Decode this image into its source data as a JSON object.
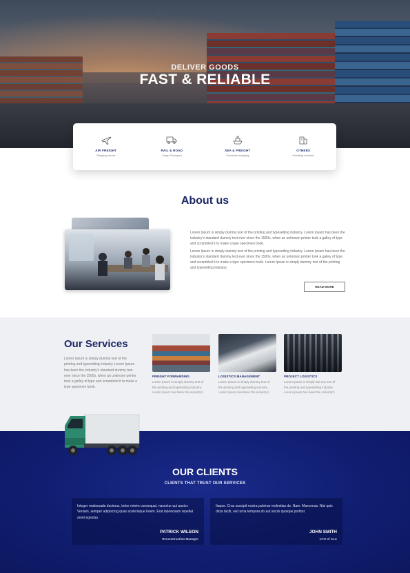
{
  "hero": {
    "subtitle": "DELIVER GOODS",
    "title": "FAST & RELIABLE"
  },
  "features": [
    {
      "icon": "airplane-icon",
      "title": "AIR FREIGHT",
      "subtitle": "Shipping via air"
    },
    {
      "icon": "truck-icon",
      "title": "RAIL & ROAD",
      "subtitle": "Cargo Transport"
    },
    {
      "icon": "ship-icon",
      "title": "SEA & FREIGHT",
      "subtitle": "Container shipping"
    },
    {
      "icon": "box-icon",
      "title": "OTHERS",
      "subtitle": "Handling services"
    }
  ],
  "about": {
    "title": "About us",
    "paragraph1": "Lorem Ipsum is simply dummy text of the printing and typesetting industry. Lorem Ipsum has been the industry's standard dummy text ever since the 1500s, when an unknown printer took a galley of type and scrambled it to make a type specimen book.",
    "paragraph2": "Lorem Ipsum is simply dummy text of the printing and typesetting industry. Lorem Ipsum has been the industry's standard dummy text ever since the 1500s, when an unknown printer took a galley of type and scrambled it to make a type specimen book. Lorem Ipsum is simply dummy text of the printing and typesetting industry.",
    "button": "READ MORE"
  },
  "services": {
    "title": "Our Services",
    "text": "Lorem Ipsum is simply dummy text of the printing and typesetting industry. Lorem Ipsum has been the industry's standard dummy text ever since the 1500s, when an unknown printer took a galley of type and scrambled it to make a type specimen book.",
    "cards": [
      {
        "title": "FREIGHT FORWARDING",
        "desc": "Lorem Ipsum is simply dummy text of the printing and typesetting industry. Lorem Ipsum has been the industry's"
      },
      {
        "title": "LOGISTICS MANAGEMENT",
        "desc": "Lorem Ipsum is simply dummy text of the printing and typesetting industry. Lorem Ipsum has been the industry's"
      },
      {
        "title": "PROJECT LOGISTICS",
        "desc": "Lorem Ipsum is simply dummy text of the printing and typesetting industry. Lorem Ipsum has been the industry's"
      }
    ]
  },
  "clients": {
    "title": "OUR CLIENTS",
    "subtitle": "CLIENTS THAT TRUST OUR SERVICES",
    "testimonials": [
      {
        "quote": "Integer malesuada ducimus, tortor minim consequat, nascetur qui auctor. Veniam, semper adipiscing quas scelerisque lorem. Erat laboriosam repellat amet egestas.",
        "name": "PATRICK WILSON",
        "role": "Reconstruction Manager"
      },
      {
        "quote": "Itaque. Cras suscipit nostra pulvinar molestias do. Nam. Maecenas. Nisi quis dicta taciti, sed urna tempora do aut sociis quisque portitor.",
        "name": "JOHN SMITH",
        "role": "CTO of CLC"
      }
    ]
  }
}
